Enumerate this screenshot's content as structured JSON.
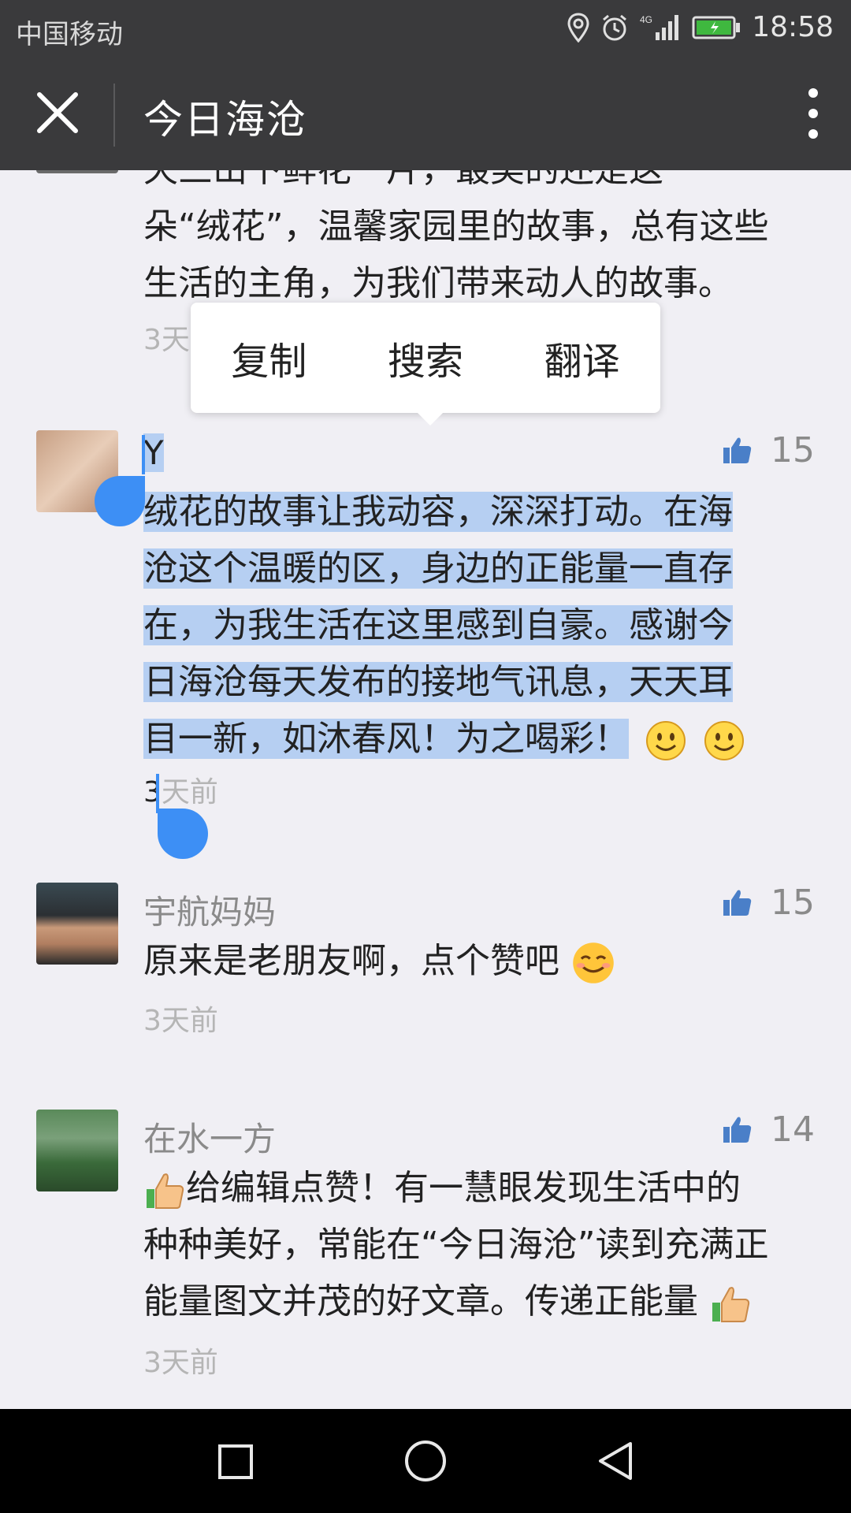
{
  "status": {
    "carrier": "中国移动",
    "network": "4G",
    "time": "18:58"
  },
  "title_bar": {
    "title": "今日海沧"
  },
  "prev_comment": {
    "line1": "天三山下鲜花一片，最美的还是这一",
    "line2": "朵“绒花”，温馨家园里的故事，总有这些",
    "line3": "生活的主角，为我们带来动人的故事。",
    "time": "3天"
  },
  "popup": {
    "copy": "复制",
    "search": "搜索",
    "translate": "翻译"
  },
  "comments": [
    {
      "name": "Y",
      "likes": "15",
      "lines": [
        "绒花的故事让我动容，深深打动。在海",
        "沧这个温暖的区，身边的正能量一直存",
        "在，为我生活在这里感到自豪。感谢今",
        "日海沧每天发布的接地气讯息，天天耳",
        "目一新，如沐春风！为之喝彩！"
      ],
      "time_prefix": "3",
      "time_suffix": "天前"
    },
    {
      "name": "宇航妈妈",
      "likes": "15",
      "text": "原来是老朋友啊，点个赞吧",
      "time": "3天前"
    },
    {
      "name": "在水一方",
      "likes": "14",
      "lines": [
        "给编辑点赞！有一慧眼发现生活中的",
        "种种美好，常能在“今日海沧”读到充满正",
        "能量图文并茂的好文章。传递正能量"
      ],
      "time": "3天前"
    }
  ],
  "icons": {
    "close": "close-icon",
    "more": "more-vertical-icon",
    "like": "thumbs-up-icon",
    "smile": "smile-emoji-icon",
    "back": "back-triangle-icon",
    "home": "home-circle-icon",
    "recents": "recents-square-icon"
  },
  "colors": {
    "bar": "#3a3a3c",
    "background": "#f0eff4",
    "highlight": "#b6cff2",
    "handle": "#3d8ff5",
    "like": "#4a7fc8"
  }
}
